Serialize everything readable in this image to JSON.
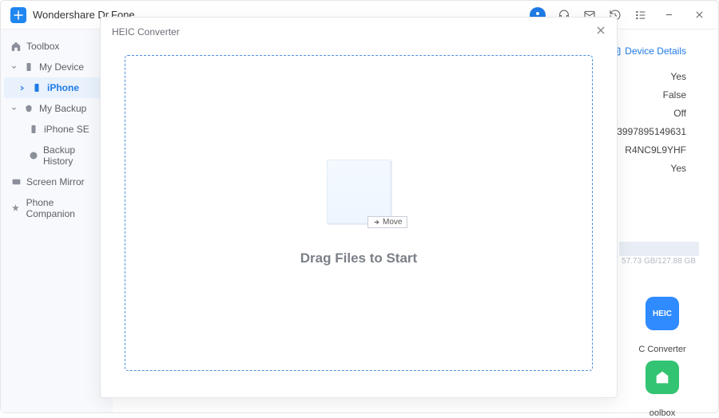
{
  "app": {
    "title": "Wondershare Dr.Fone"
  },
  "sidebar": {
    "items": [
      {
        "label": "Toolbox"
      },
      {
        "label": "My Device"
      },
      {
        "label": "iPhone"
      },
      {
        "label": "My Backup"
      },
      {
        "label": "iPhone SE"
      },
      {
        "label": "Backup History"
      },
      {
        "label": "Screen Mirror"
      },
      {
        "label": "Phone Companion"
      }
    ]
  },
  "details": {
    "link": "Device Details",
    "values": [
      "Yes",
      "False",
      "Off",
      "3997895149631",
      "R4NC9L9YHF",
      "Yes"
    ],
    "storage": "57.73 GB/127.88 GB"
  },
  "tiles": {
    "heic": {
      "badge": "HEIC",
      "label": "C Converter"
    },
    "toolbox": {
      "label": "oolbox"
    }
  },
  "modal": {
    "title": "HEIC Converter",
    "move_label": "Move",
    "drop_text": "Drag  Files to Start"
  }
}
